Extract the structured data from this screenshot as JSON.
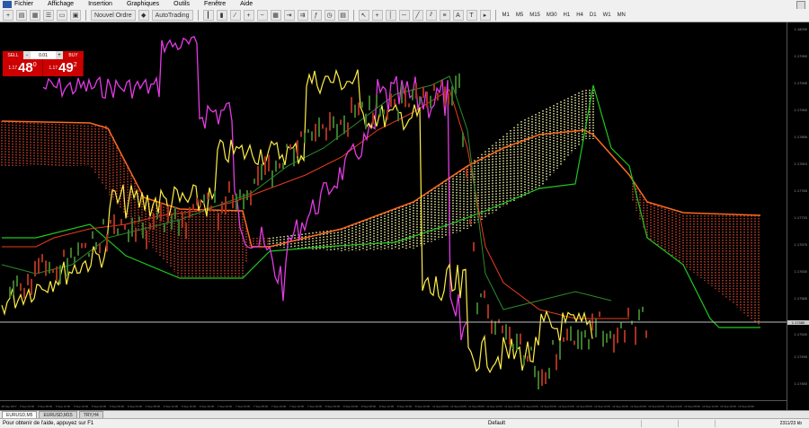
{
  "menu": [
    "Fichier",
    "Affichage",
    "Insertion",
    "Graphiques",
    "Outils",
    "Fenêtre",
    "Aide"
  ],
  "toolbar": {
    "new_order": "Nouvel Ordre",
    "autotrading": "AutoTrading",
    "periods": [
      "M1",
      "M5",
      "M15",
      "M30",
      "H1",
      "H4",
      "D1",
      "W1",
      "MN"
    ]
  },
  "trade_panel": {
    "sell_label": "SELL",
    "buy_label": "BUY",
    "lot": "0.01",
    "minus": "-",
    "plus": "+",
    "sell_prefix": "1.17",
    "sell_big": "48",
    "sell_sup": "0",
    "buy_prefix": "1.17",
    "buy_big": "49",
    "buy_sup": "2"
  },
  "price_axis": {
    "ticks": [
      "1.18035",
      "1.17990",
      "1.17945",
      "1.17900",
      "1.17855",
      "1.17810",
      "1.17765",
      "1.17720",
      "1.17675",
      "1.17630",
      "1.17585",
      "1.17540",
      "1.17495",
      "1.17450"
    ],
    "current_price": "1.17480"
  },
  "time_axis": {
    "labels": [
      "28 Sep 2017",
      "5 Sep 04:00",
      "5 Sep 08:00",
      "5 Sep 12:00",
      "5 Sep 16:00",
      "5 Sep 20:00",
      "6 Sep 00:00",
      "6 Sep 04:00",
      "6 Sep 08:00",
      "6 Sep 12:00",
      "6 Sep 16:00",
      "6 Sep 20:00",
      "7 Sep 00:00",
      "7 Sep 04:00",
      "7 Sep 08:00",
      "7 Sep 12:00",
      "7 Sep 16:00",
      "7 Sep 20:00",
      "8 Sep 00:00",
      "8 Sep 04:00",
      "8 Sep 08:00",
      "8 Sep 12:00",
      "8 Sep 16:00",
      "8 Sep 20:00",
      "11 Sep 00:00",
      "11 Sep 04:00",
      "11 Sep 08:00",
      "11 Sep 12:00",
      "11 Sep 16:00",
      "11 Sep 20:00",
      "12 Sep 00:00",
      "12 Sep 04:00",
      "12 Sep 08:00",
      "12 Sep 12:00",
      "12 Sep 16:00",
      "12 Sep 20:00",
      "13 Sep 00:00",
      "13 Sep 04:00",
      "13 Sep 08:00",
      "13 Sep 12:00",
      "13 Sep 16:00",
      "13 Sep 20:00"
    ]
  },
  "tabs": [
    {
      "label": "EURUSD,M5",
      "active": true
    },
    {
      "label": "EURUSD,M15",
      "active": false
    },
    {
      "label": "TRY,H4",
      "active": false
    }
  ],
  "status": {
    "help": "Pour obtenir de l'aide, appuyez sur F1",
    "profile": "Default",
    "connection": "2311/23 kb"
  }
}
